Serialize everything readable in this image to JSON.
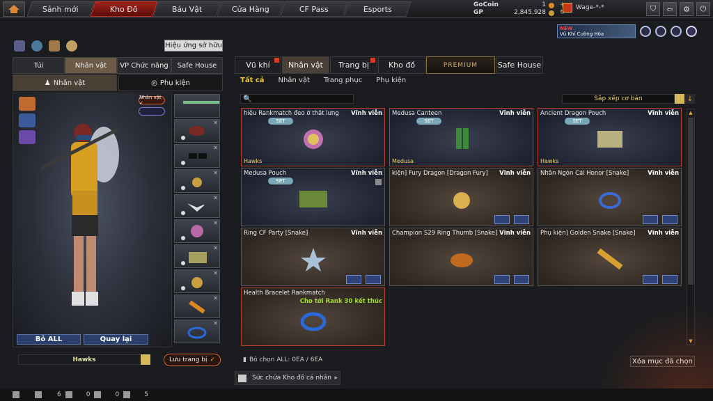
{
  "nav": {
    "tabs": [
      {
        "label": "Sảnh mới"
      },
      {
        "label": "Kho Đồ"
      },
      {
        "label": "Báu Vật"
      },
      {
        "label": "Cửa Hàng"
      },
      {
        "label": "CF Pass"
      },
      {
        "label": "Esports"
      }
    ],
    "active": "Kho Đồ"
  },
  "currency": {
    "gocoin_label": "GoCoin",
    "gocoin_value": "1",
    "gp_label": "GP",
    "gp_value": "2,845,928"
  },
  "player": {
    "name": "Wage-*-*"
  },
  "promo": {
    "new_tag": "NEW",
    "text": "Vũ Khí Cường Hóa"
  },
  "left": {
    "effect_button": "Hiệu ứng sở hữu",
    "tabs": [
      "Túi",
      "Nhân vật",
      "VP Chức năng",
      "Safe House"
    ],
    "subtabs": [
      "Nhân vật",
      "Phụ kiện"
    ],
    "char_badge": "Nhân vật ✓",
    "clear_all": "Bỏ ALL",
    "back": "Quay lại",
    "name_field": "Hawks",
    "save_button": "Lưu trang bị"
  },
  "right": {
    "tabs": [
      "Vũ khí",
      "Nhân vật",
      "Trang bị",
      "Kho đồ",
      "PREMIUM",
      "Safe House"
    ],
    "filters": [
      "Tất cả",
      "Nhân vật",
      "Trang phục",
      "Phụ kiện"
    ],
    "sort_label": "Sắp xếp cơ bản",
    "items": [
      {
        "name": "hiệu Rankmatch đeo ở thắt lưng",
        "perm": "Vĩnh viễn",
        "set": "SET",
        "owner": "Hawks",
        "note": ""
      },
      {
        "name": "Medusa Canteen",
        "perm": "Vĩnh viễn",
        "set": "SET",
        "owner": "Medusa",
        "note": ""
      },
      {
        "name": "Ancient Dragon Pouch",
        "perm": "Vĩnh viễn",
        "set": "SET",
        "owner": "Hawks",
        "note": ""
      },
      {
        "name": "Medusa Pouch",
        "perm": "Vĩnh viễn",
        "set": "SET",
        "owner": "",
        "note": ""
      },
      {
        "name": "kiện] Fury Dragon [Dragon Fury]",
        "perm": "Vĩnh viễn",
        "set": "",
        "owner": "",
        "note": ""
      },
      {
        "name": "Nhẫn Ngón Cái Honor [Snake]",
        "perm": "Vĩnh viễn",
        "set": "",
        "owner": "",
        "note": ""
      },
      {
        "name": "Ring CF Party [Snake]",
        "perm": "Vĩnh viễn",
        "set": "",
        "owner": "",
        "note": ""
      },
      {
        "name": "Champion S29 Ring Thumb [Snake]",
        "perm": "Vĩnh viễn",
        "set": "",
        "owner": "",
        "note": ""
      },
      {
        "name": "Phụ kiện] Golden Snake [Snake]",
        "perm": "Vĩnh viễn",
        "set": "",
        "owner": "",
        "note": ""
      },
      {
        "name": "Health Bracelet Rankmatch",
        "perm": "",
        "set": "",
        "owner": "",
        "note": "Cho tới Rank 30 kết thúc"
      }
    ],
    "deselect_text": "Bỏ chọn ALL: 0EA / 6EA",
    "clear_selected": "Xóa mục đã chọn",
    "storage": "Sức chứa Kho đồ cá nhân"
  },
  "status": {
    "a": "6",
    "b": "0",
    "c": "0",
    "d": "5"
  }
}
